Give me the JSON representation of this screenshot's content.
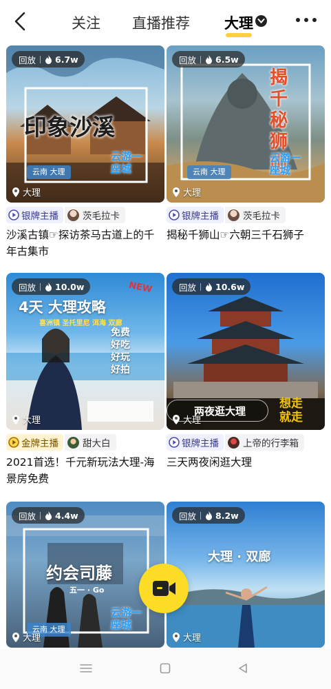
{
  "header": {
    "tabs": [
      "关注",
      "直播推荐",
      "大理"
    ],
    "active_tab_index": 2
  },
  "icons": {
    "back": "back-arrow-icon",
    "dropdown": "chevron-down-icon",
    "more": "more-dots-icon",
    "camera": "video-camera-icon",
    "nav_menu": "menu-lines-icon",
    "nav_home": "square-home-icon",
    "nav_back": "triangle-back-icon"
  },
  "accent_color": "#fddc26",
  "cards": [
    {
      "replay_label": "回放",
      "views": "6.7w",
      "location": "大理",
      "overlay_title": "印象沙溪",
      "overlay_tag": "云南 大理",
      "overlay_stamp": "云游一座城",
      "badge": "银牌主播",
      "anchor": "茨毛拉卡",
      "title": "沙溪古镇☞探访茶马古道上的千年古集市"
    },
    {
      "replay_label": "回放",
      "views": "6.5w",
      "location": "大理",
      "overlay_title": "揭千秘狮山",
      "overlay_tag": "云南 大理",
      "overlay_stamp": "云游一座城",
      "badge": "银牌主播",
      "anchor": "茨毛拉卡",
      "title": "揭秘千狮山☞六朝三千石狮子"
    },
    {
      "replay_label": "回放",
      "views": "10.0w",
      "location": "大理",
      "overlay_title": "4天 大理攻略",
      "overlay_sub": "喜洲镇 圣托里尼 洱海 双廊",
      "overlay_new": "NEW",
      "overlay_list": [
        "免费",
        "好吃",
        "好玩",
        "好拍"
      ],
      "badge": "金牌主播",
      "anchor": "甜大白",
      "title": "2021首选！千元新玩法大理-海景房免费"
    },
    {
      "replay_label": "回放",
      "views": "10.6w",
      "location": "大理",
      "overlay_title": "两夜逛大理",
      "overlay_side": "想走就走",
      "badge": "银牌主播",
      "anchor": "上帝的行李箱",
      "title": "三天两夜闲逛大理"
    },
    {
      "replay_label": "回放",
      "views": "4.4w",
      "location": "大理",
      "overlay_title": "约会司藤",
      "overlay_sub": "五一 · Go",
      "overlay_tag": "云南 大理",
      "overlay_stamp": "云游一座城"
    },
    {
      "replay_label": "回放",
      "views": "8.2w",
      "location": "大理",
      "overlay_title": "大理 · 双廊"
    }
  ]
}
